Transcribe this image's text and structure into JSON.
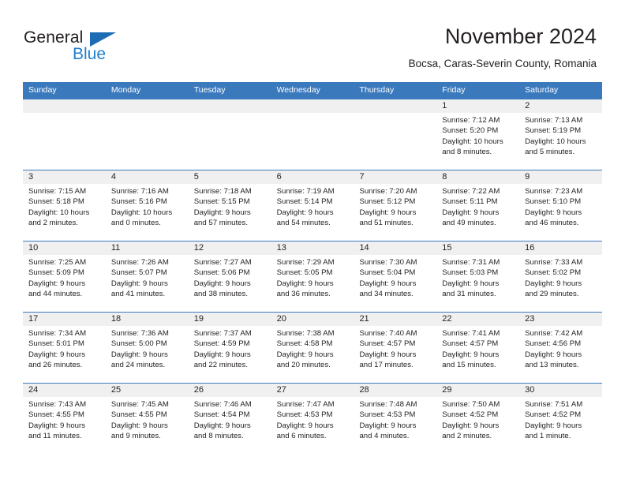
{
  "brand": {
    "name_top": "General",
    "name_bottom": "Blue",
    "accent_color": "#2180cf",
    "triangle_color": "#1b6cb5"
  },
  "header": {
    "title": "November 2024",
    "subtitle": "Bocsa, Caras-Severin County, Romania"
  },
  "calendar": {
    "header_bg": "#3b79bd",
    "weekday_headers": [
      "Sunday",
      "Monday",
      "Tuesday",
      "Wednesday",
      "Thursday",
      "Friday",
      "Saturday"
    ],
    "weeks": [
      [
        {
          "day": "",
          "blank": true,
          "sunrise": "",
          "sunset": "",
          "daylight_line1": "",
          "daylight_line2": ""
        },
        {
          "day": "",
          "blank": true,
          "sunrise": "",
          "sunset": "",
          "daylight_line1": "",
          "daylight_line2": ""
        },
        {
          "day": "",
          "blank": true,
          "sunrise": "",
          "sunset": "",
          "daylight_line1": "",
          "daylight_line2": ""
        },
        {
          "day": "",
          "blank": true,
          "sunrise": "",
          "sunset": "",
          "daylight_line1": "",
          "daylight_line2": ""
        },
        {
          "day": "",
          "blank": true,
          "sunrise": "",
          "sunset": "",
          "daylight_line1": "",
          "daylight_line2": ""
        },
        {
          "day": "1",
          "blank": false,
          "sunrise": "Sunrise: 7:12 AM",
          "sunset": "Sunset: 5:20 PM",
          "daylight_line1": "Daylight: 10 hours",
          "daylight_line2": "and 8 minutes."
        },
        {
          "day": "2",
          "blank": false,
          "sunrise": "Sunrise: 7:13 AM",
          "sunset": "Sunset: 5:19 PM",
          "daylight_line1": "Daylight: 10 hours",
          "daylight_line2": "and 5 minutes."
        }
      ],
      [
        {
          "day": "3",
          "blank": false,
          "sunrise": "Sunrise: 7:15 AM",
          "sunset": "Sunset: 5:18 PM",
          "daylight_line1": "Daylight: 10 hours",
          "daylight_line2": "and 2 minutes."
        },
        {
          "day": "4",
          "blank": false,
          "sunrise": "Sunrise: 7:16 AM",
          "sunset": "Sunset: 5:16 PM",
          "daylight_line1": "Daylight: 10 hours",
          "daylight_line2": "and 0 minutes."
        },
        {
          "day": "5",
          "blank": false,
          "sunrise": "Sunrise: 7:18 AM",
          "sunset": "Sunset: 5:15 PM",
          "daylight_line1": "Daylight: 9 hours",
          "daylight_line2": "and 57 minutes."
        },
        {
          "day": "6",
          "blank": false,
          "sunrise": "Sunrise: 7:19 AM",
          "sunset": "Sunset: 5:14 PM",
          "daylight_line1": "Daylight: 9 hours",
          "daylight_line2": "and 54 minutes."
        },
        {
          "day": "7",
          "blank": false,
          "sunrise": "Sunrise: 7:20 AM",
          "sunset": "Sunset: 5:12 PM",
          "daylight_line1": "Daylight: 9 hours",
          "daylight_line2": "and 51 minutes."
        },
        {
          "day": "8",
          "blank": false,
          "sunrise": "Sunrise: 7:22 AM",
          "sunset": "Sunset: 5:11 PM",
          "daylight_line1": "Daylight: 9 hours",
          "daylight_line2": "and 49 minutes."
        },
        {
          "day": "9",
          "blank": false,
          "sunrise": "Sunrise: 7:23 AM",
          "sunset": "Sunset: 5:10 PM",
          "daylight_line1": "Daylight: 9 hours",
          "daylight_line2": "and 46 minutes."
        }
      ],
      [
        {
          "day": "10",
          "blank": false,
          "sunrise": "Sunrise: 7:25 AM",
          "sunset": "Sunset: 5:09 PM",
          "daylight_line1": "Daylight: 9 hours",
          "daylight_line2": "and 44 minutes."
        },
        {
          "day": "11",
          "blank": false,
          "sunrise": "Sunrise: 7:26 AM",
          "sunset": "Sunset: 5:07 PM",
          "daylight_line1": "Daylight: 9 hours",
          "daylight_line2": "and 41 minutes."
        },
        {
          "day": "12",
          "blank": false,
          "sunrise": "Sunrise: 7:27 AM",
          "sunset": "Sunset: 5:06 PM",
          "daylight_line1": "Daylight: 9 hours",
          "daylight_line2": "and 38 minutes."
        },
        {
          "day": "13",
          "blank": false,
          "sunrise": "Sunrise: 7:29 AM",
          "sunset": "Sunset: 5:05 PM",
          "daylight_line1": "Daylight: 9 hours",
          "daylight_line2": "and 36 minutes."
        },
        {
          "day": "14",
          "blank": false,
          "sunrise": "Sunrise: 7:30 AM",
          "sunset": "Sunset: 5:04 PM",
          "daylight_line1": "Daylight: 9 hours",
          "daylight_line2": "and 34 minutes."
        },
        {
          "day": "15",
          "blank": false,
          "sunrise": "Sunrise: 7:31 AM",
          "sunset": "Sunset: 5:03 PM",
          "daylight_line1": "Daylight: 9 hours",
          "daylight_line2": "and 31 minutes."
        },
        {
          "day": "16",
          "blank": false,
          "sunrise": "Sunrise: 7:33 AM",
          "sunset": "Sunset: 5:02 PM",
          "daylight_line1": "Daylight: 9 hours",
          "daylight_line2": "and 29 minutes."
        }
      ],
      [
        {
          "day": "17",
          "blank": false,
          "sunrise": "Sunrise: 7:34 AM",
          "sunset": "Sunset: 5:01 PM",
          "daylight_line1": "Daylight: 9 hours",
          "daylight_line2": "and 26 minutes."
        },
        {
          "day": "18",
          "blank": false,
          "sunrise": "Sunrise: 7:36 AM",
          "sunset": "Sunset: 5:00 PM",
          "daylight_line1": "Daylight: 9 hours",
          "daylight_line2": "and 24 minutes."
        },
        {
          "day": "19",
          "blank": false,
          "sunrise": "Sunrise: 7:37 AM",
          "sunset": "Sunset: 4:59 PM",
          "daylight_line1": "Daylight: 9 hours",
          "daylight_line2": "and 22 minutes."
        },
        {
          "day": "20",
          "blank": false,
          "sunrise": "Sunrise: 7:38 AM",
          "sunset": "Sunset: 4:58 PM",
          "daylight_line1": "Daylight: 9 hours",
          "daylight_line2": "and 20 minutes."
        },
        {
          "day": "21",
          "blank": false,
          "sunrise": "Sunrise: 7:40 AM",
          "sunset": "Sunset: 4:57 PM",
          "daylight_line1": "Daylight: 9 hours",
          "daylight_line2": "and 17 minutes."
        },
        {
          "day": "22",
          "blank": false,
          "sunrise": "Sunrise: 7:41 AM",
          "sunset": "Sunset: 4:57 PM",
          "daylight_line1": "Daylight: 9 hours",
          "daylight_line2": "and 15 minutes."
        },
        {
          "day": "23",
          "blank": false,
          "sunrise": "Sunrise: 7:42 AM",
          "sunset": "Sunset: 4:56 PM",
          "daylight_line1": "Daylight: 9 hours",
          "daylight_line2": "and 13 minutes."
        }
      ],
      [
        {
          "day": "24",
          "blank": false,
          "sunrise": "Sunrise: 7:43 AM",
          "sunset": "Sunset: 4:55 PM",
          "daylight_line1": "Daylight: 9 hours",
          "daylight_line2": "and 11 minutes."
        },
        {
          "day": "25",
          "blank": false,
          "sunrise": "Sunrise: 7:45 AM",
          "sunset": "Sunset: 4:55 PM",
          "daylight_line1": "Daylight: 9 hours",
          "daylight_line2": "and 9 minutes."
        },
        {
          "day": "26",
          "blank": false,
          "sunrise": "Sunrise: 7:46 AM",
          "sunset": "Sunset: 4:54 PM",
          "daylight_line1": "Daylight: 9 hours",
          "daylight_line2": "and 8 minutes."
        },
        {
          "day": "27",
          "blank": false,
          "sunrise": "Sunrise: 7:47 AM",
          "sunset": "Sunset: 4:53 PM",
          "daylight_line1": "Daylight: 9 hours",
          "daylight_line2": "and 6 minutes."
        },
        {
          "day": "28",
          "blank": false,
          "sunrise": "Sunrise: 7:48 AM",
          "sunset": "Sunset: 4:53 PM",
          "daylight_line1": "Daylight: 9 hours",
          "daylight_line2": "and 4 minutes."
        },
        {
          "day": "29",
          "blank": false,
          "sunrise": "Sunrise: 7:50 AM",
          "sunset": "Sunset: 4:52 PM",
          "daylight_line1": "Daylight: 9 hours",
          "daylight_line2": "and 2 minutes."
        },
        {
          "day": "30",
          "blank": false,
          "sunrise": "Sunrise: 7:51 AM",
          "sunset": "Sunset: 4:52 PM",
          "daylight_line1": "Daylight: 9 hours",
          "daylight_line2": "and 1 minute."
        }
      ]
    ]
  }
}
